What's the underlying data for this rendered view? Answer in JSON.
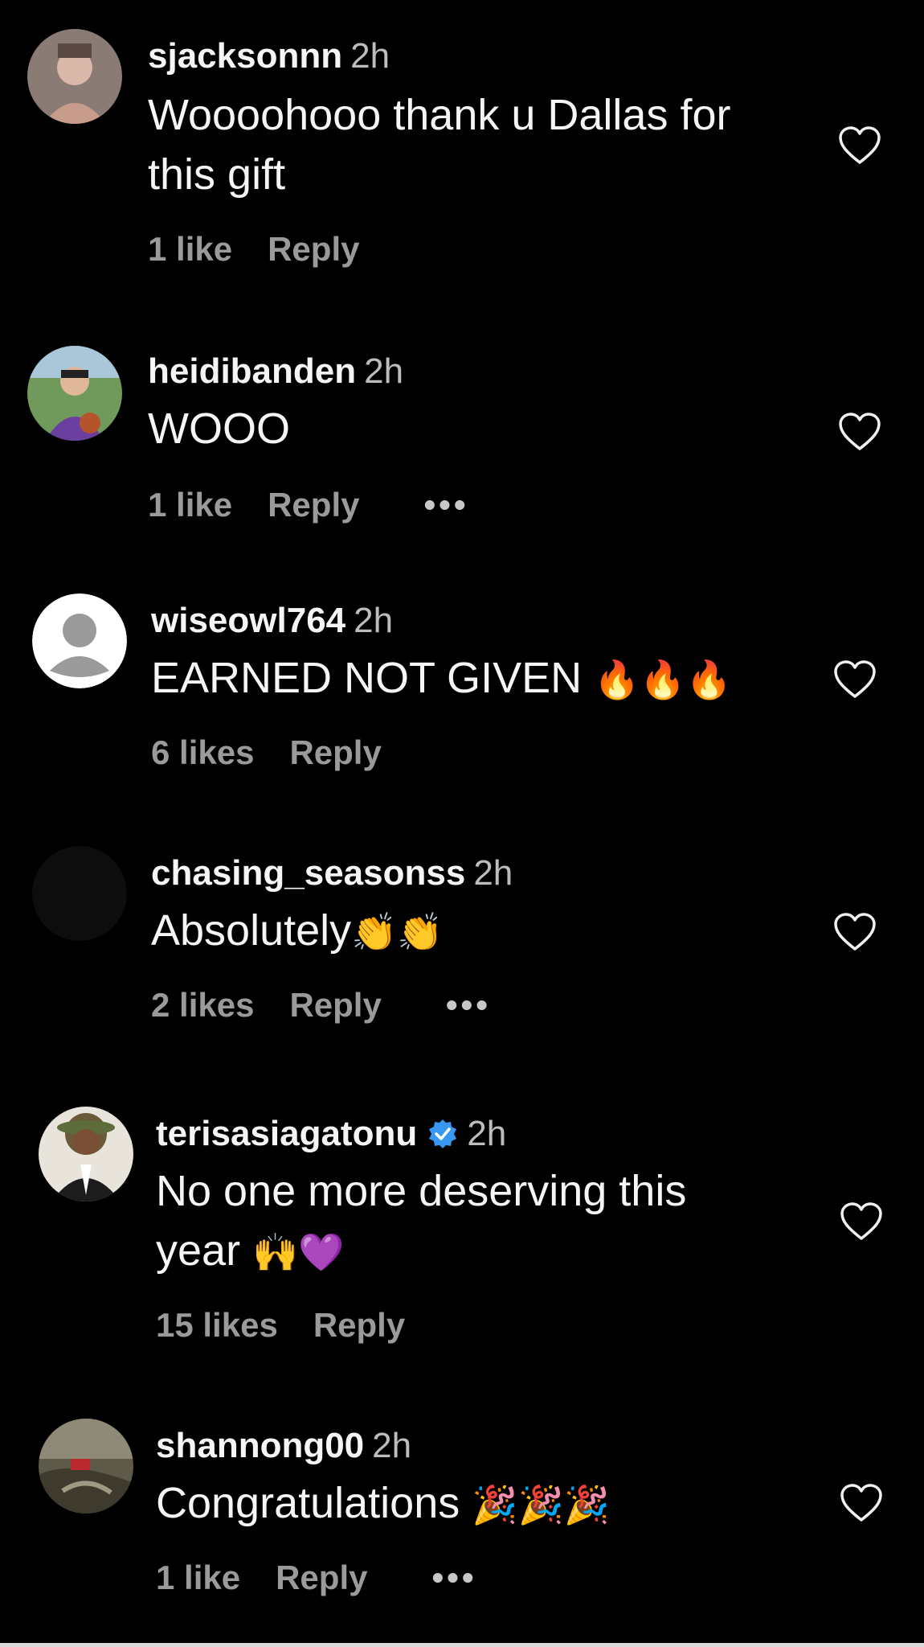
{
  "comments": [
    {
      "username": "sjacksonnn",
      "time": "2h",
      "text_line1": "Woooohooo thank u Dallas for",
      "text_line2": "this gift",
      "likes": "1 like",
      "reply": "Reply",
      "avatar_icon": "user-photo-avatar"
    },
    {
      "username": "heidibanden",
      "time": "2h",
      "text": "WOOO",
      "likes": "1 like",
      "reply": "Reply",
      "more": "•••",
      "avatar_icon": "user-photo-avatar"
    },
    {
      "username": "wiseowl764",
      "time": "2h",
      "text": "EARNED NOT GIVEN",
      "emoji": "🔥🔥🔥",
      "likes": "6 likes",
      "reply": "Reply",
      "avatar_icon": "default-person-avatar"
    },
    {
      "username": "chasing_seasonss",
      "time": "2h",
      "text": "Absolutely",
      "emoji": "👏👏",
      "likes": "2 likes",
      "reply": "Reply",
      "more": "•••",
      "avatar_icon": "dark-avatar"
    },
    {
      "username": "terisasiagatonu",
      "time": "2h",
      "verified": true,
      "text_line1": "No one more deserving this",
      "text_line2": "year",
      "emoji": "🙌💜",
      "likes": "15 likes",
      "reply": "Reply",
      "avatar_icon": "user-photo-avatar"
    },
    {
      "username": "shannong00",
      "time": "2h",
      "text": "Congratulations",
      "emoji": "🎉🎉🎉",
      "likes": "1 like",
      "reply": "Reply",
      "more": "•••",
      "avatar_icon": "user-photo-avatar"
    }
  ],
  "colors": {
    "background": "#000000",
    "text": "#f5f5f5",
    "secondary": "#9a9a9a",
    "verified_blue": "#3897f0"
  }
}
